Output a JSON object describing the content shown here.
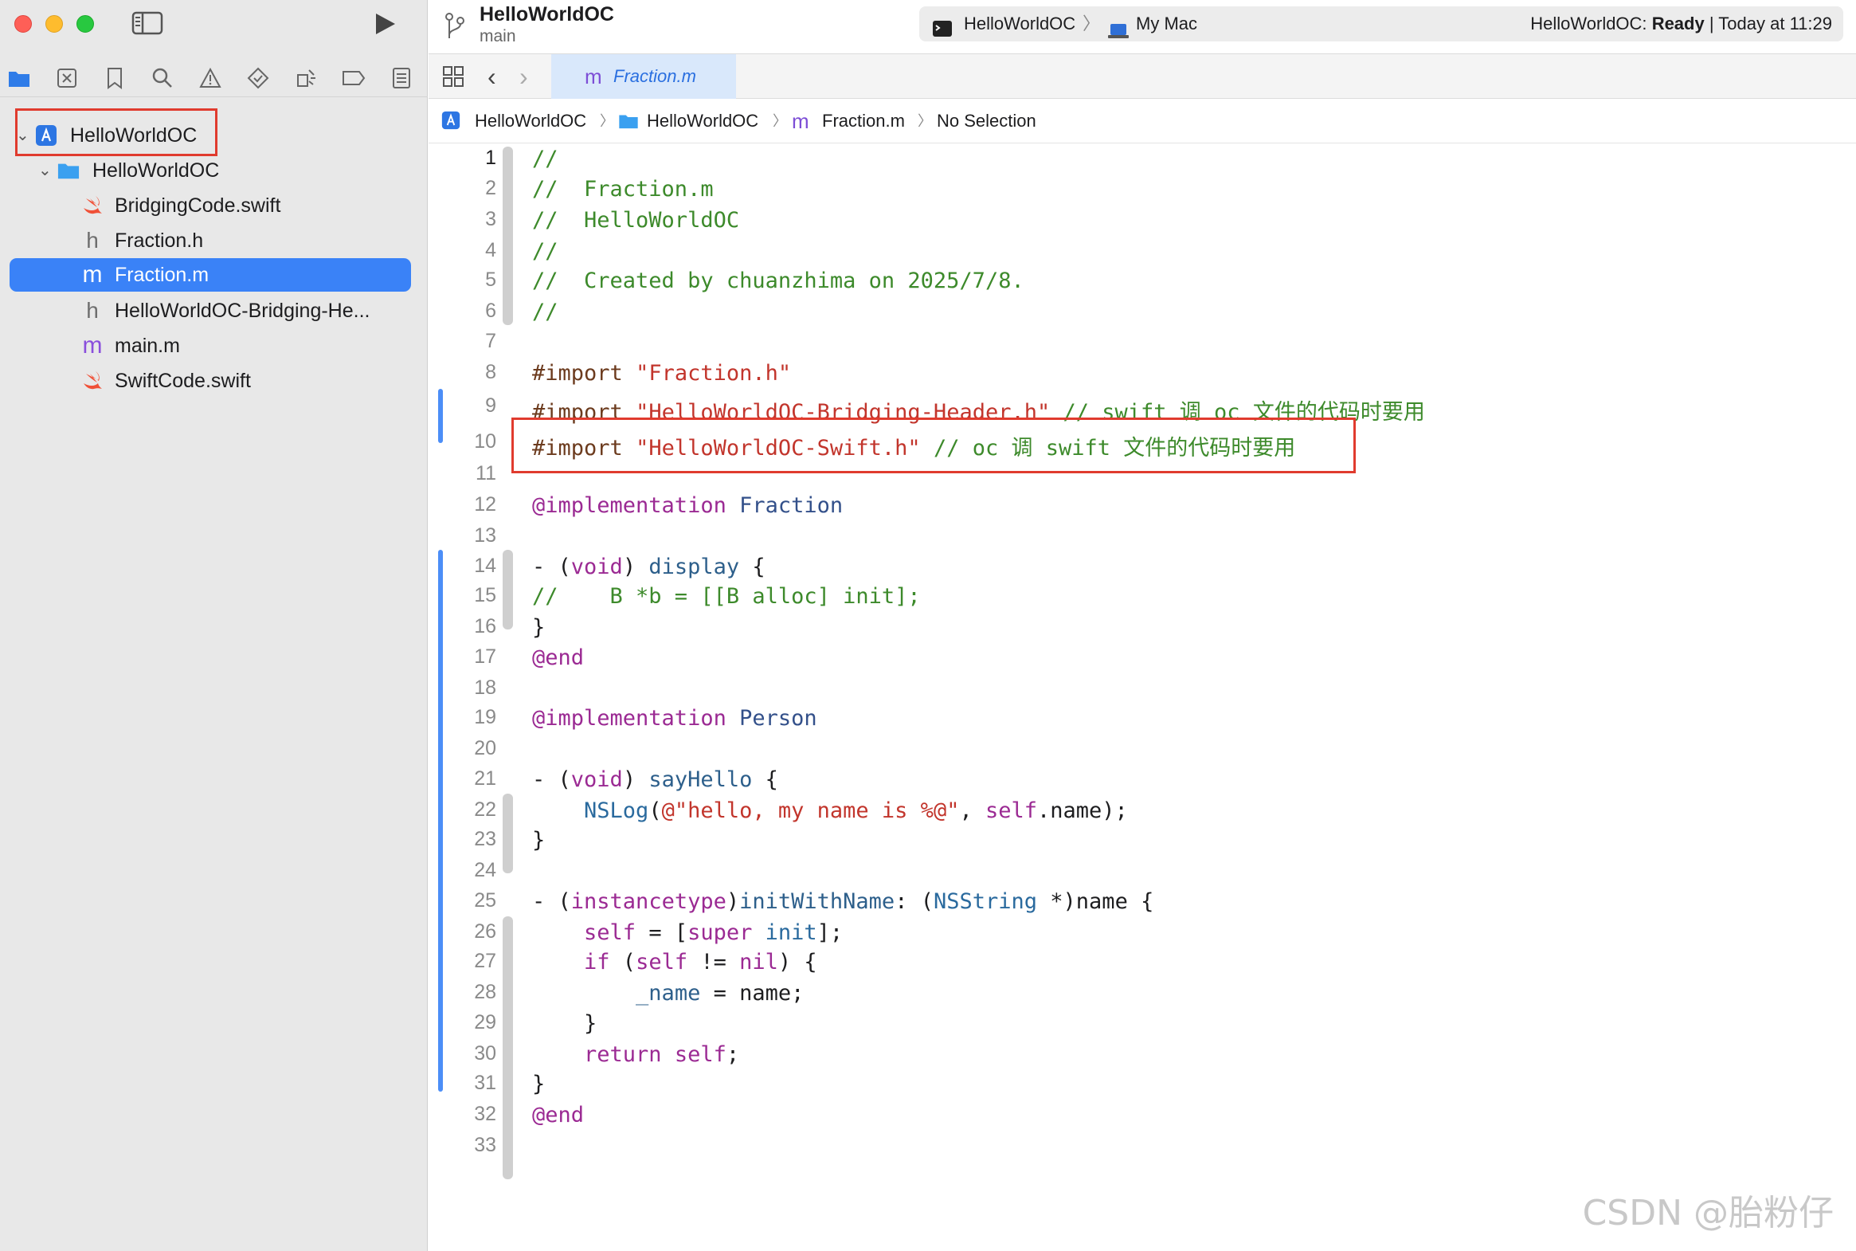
{
  "window": {
    "project_title": "HelloWorldOC",
    "branch": "main",
    "scheme": "HelloWorldOC",
    "scheme_separator": "〉",
    "destination": "My Mac",
    "status_app": "HelloWorldOC:",
    "status_state": "Ready",
    "status_time": "| Today at 11:29"
  },
  "navigator": {
    "icons": [
      "folder-icon",
      "source-control-icon",
      "bookmark-icon",
      "find-icon",
      "issue-icon",
      "test-icon",
      "debug-icon",
      "breakpoint-icon",
      "report-icon"
    ],
    "tree": [
      {
        "label": "HelloWorldOC",
        "kind": "project"
      },
      {
        "label": "HelloWorldOC",
        "kind": "folder"
      },
      {
        "label": "BridgingCode.swift",
        "kind": "swift"
      },
      {
        "label": "Fraction.h",
        "kind": "h"
      },
      {
        "label": "Fraction.m",
        "kind": "m"
      },
      {
        "label": "HelloWorldOC-Bridging-He...",
        "kind": "h"
      },
      {
        "label": "main.m",
        "kind": "m"
      },
      {
        "label": "SwiftCode.swift",
        "kind": "swift"
      }
    ],
    "selected": "Fraction.m"
  },
  "tab": {
    "label": "Fraction.m"
  },
  "jumpbar": {
    "project": "HelloWorldOC",
    "folder": "HelloWorldOC",
    "file": "Fraction.m",
    "selection": "No Selection",
    "sep": "〉"
  },
  "editor": {
    "current_line": 1,
    "line_numbers": [
      "1",
      "2",
      "3",
      "4",
      "5",
      "6",
      "7",
      "8",
      "9",
      "10",
      "11",
      "12",
      "13",
      "14",
      "15",
      "16",
      "17",
      "18",
      "19",
      "20",
      "21",
      "22",
      "23",
      "24",
      "25",
      "26",
      "27",
      "28",
      "29",
      "30",
      "31",
      "32",
      "33"
    ],
    "lines": [
      "//",
      "//  Fraction.m",
      "//  HelloWorldOC",
      "//",
      "//  Created by chuanzhima on 2025/7/8.",
      "//",
      "",
      "#import \"Fraction.h\"",
      "#import \"HelloWorldOC-Bridging-Header.h\" // swift 调 oc 文件的代码时要用",
      "#import \"HelloWorldOC-Swift.h\" // oc 调 swift 文件的代码时要用",
      "",
      "@implementation Fraction",
      "",
      "- (void) display {",
      "//    B *b = [[B alloc] init];",
      "}",
      "@end",
      "",
      "@implementation Person",
      "",
      "- (void) sayHello {",
      "    NSLog(@\"hello, my name is %@\", self.name);",
      "}",
      "",
      "- (instancetype)initWithName: (NSString *)name {",
      "    self = [super init];",
      "    if (self != nil) {",
      "        _name = name;",
      "    }",
      "    return self;",
      "}",
      "@end",
      ""
    ]
  },
  "watermark": "CSDN @胎粉仔"
}
